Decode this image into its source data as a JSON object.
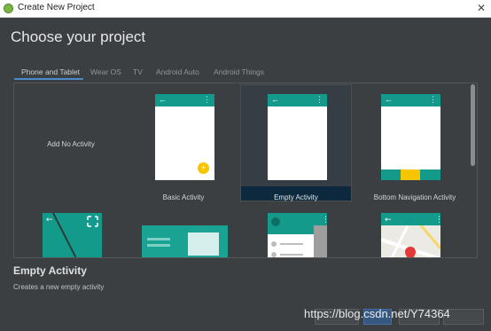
{
  "window": {
    "title": "Create New Project",
    "close_glyph": "✕"
  },
  "header": {
    "heading": "Choose your project"
  },
  "tabs": [
    {
      "label": "Phone and Tablet",
      "active": true
    },
    {
      "label": "Wear OS"
    },
    {
      "label": "TV"
    },
    {
      "label": "Android Auto"
    },
    {
      "label": "Android Things"
    }
  ],
  "templates": {
    "no_activity": "Add No Activity",
    "basic": "Basic Activity",
    "empty": "Empty Activity",
    "bottom_nav": "Bottom Navigation Activity",
    "fab_glyph": "+"
  },
  "detail": {
    "title": "Empty Activity",
    "description": "Creates a new empty activity"
  },
  "watermark": "https://blog.csdn.net/Y74364",
  "colors": {
    "teal": "#139a8a",
    "accent": "#f7c500",
    "background": "#3c3f41",
    "selection_bar": "#0d293e"
  },
  "icons": {
    "back": "arrow-left",
    "menu": "overflow-dots",
    "fullscreen": "fullscreen-corners",
    "map_pin": "map-pin"
  }
}
